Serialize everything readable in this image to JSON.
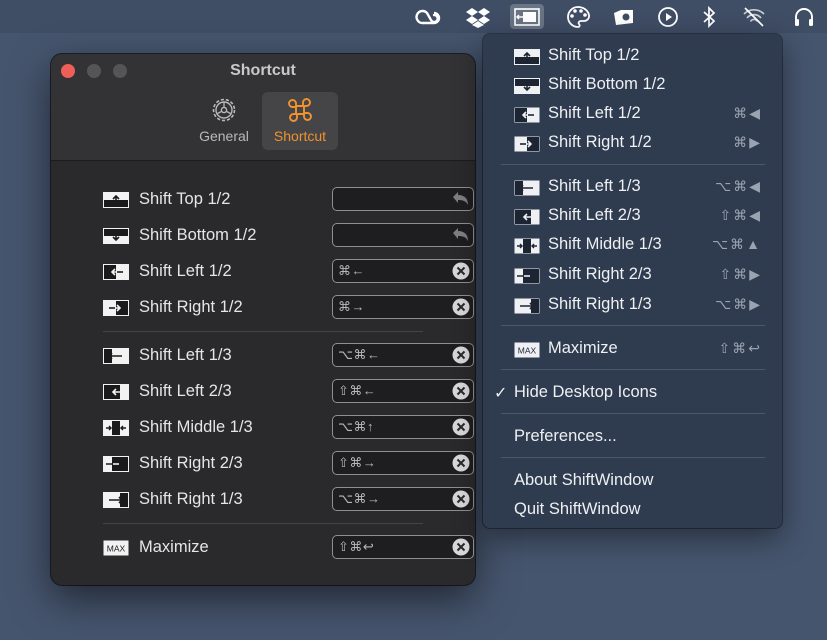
{
  "window": {
    "title": "Shortcut",
    "tabs": [
      {
        "label": "General",
        "icon": "gear-icon"
      },
      {
        "label": "Shortcut",
        "icon": "command-icon"
      }
    ],
    "shortcuts": [
      {
        "label": "Shift Top 1/2",
        "keys": "",
        "icon": "shift-top-half-icon"
      },
      {
        "label": "Shift Bottom 1/2",
        "keys": "",
        "icon": "shift-bottom-half-icon"
      },
      {
        "label": "Shift Left 1/2",
        "keys": "⌘←",
        "icon": "shift-left-half-icon"
      },
      {
        "label": "Shift Right 1/2",
        "keys": "⌘→",
        "icon": "shift-right-half-icon"
      },
      {
        "label": "Shift Left 1/3",
        "keys": "⌥⌘←",
        "icon": "shift-left-third-icon"
      },
      {
        "label": "Shift Left 2/3",
        "keys": "⇧⌘←",
        "icon": "shift-left-two-thirds-icon"
      },
      {
        "label": "Shift Middle 1/3",
        "keys": "⌥⌘↑",
        "icon": "shift-middle-third-icon"
      },
      {
        "label": "Shift Right 2/3",
        "keys": "⇧⌘→",
        "icon": "shift-right-two-thirds-icon"
      },
      {
        "label": "Shift Right 1/3",
        "keys": "⌥⌘→",
        "icon": "shift-right-third-icon"
      },
      {
        "label": "Maximize",
        "keys": "⇧⌘↩",
        "icon": "maximize-icon"
      }
    ]
  },
  "menubar": {
    "icons": [
      "creative-cloud-icon",
      "dropbox-icon",
      "shiftwindow-icon",
      "palette-icon",
      "camera-icon",
      "play-icon",
      "bluetooth-icon",
      "wifi-off-icon",
      "headphones-icon"
    ]
  },
  "menu": {
    "items": [
      {
        "label": "Shift Top 1/2",
        "shortcut": "",
        "icon": "shift-top-half-icon"
      },
      {
        "label": "Shift Bottom 1/2",
        "shortcut": "",
        "icon": "shift-bottom-half-icon"
      },
      {
        "label": "Shift Left 1/2",
        "shortcut": "⌘◀",
        "icon": "shift-left-half-icon"
      },
      {
        "label": "Shift Right 1/2",
        "shortcut": "⌘▶",
        "icon": "shift-right-half-icon"
      },
      {
        "label": "Shift Left 1/3",
        "shortcut": "⌥⌘◀",
        "icon": "shift-left-third-icon"
      },
      {
        "label": "Shift Left 2/3",
        "shortcut": "⇧⌘◀",
        "icon": "shift-left-two-thirds-icon"
      },
      {
        "label": "Shift Middle 1/3",
        "shortcut": "⌥⌘▲",
        "icon": "shift-middle-third-icon"
      },
      {
        "label": "Shift Right 2/3",
        "shortcut": "⇧⌘▶",
        "icon": "shift-right-two-thirds-icon"
      },
      {
        "label": "Shift Right 1/3",
        "shortcut": "⌥⌘▶",
        "icon": "shift-right-third-icon"
      },
      {
        "label": "Maximize",
        "shortcut": "⇧⌘↩",
        "icon": "maximize-icon"
      }
    ],
    "hide_desktop_icons": "Hide Desktop Icons",
    "check": "✓",
    "preferences": "Preferences...",
    "about": "About ShiftWindow",
    "quit": "Quit ShiftWindow",
    "max_badge": "MAX"
  }
}
